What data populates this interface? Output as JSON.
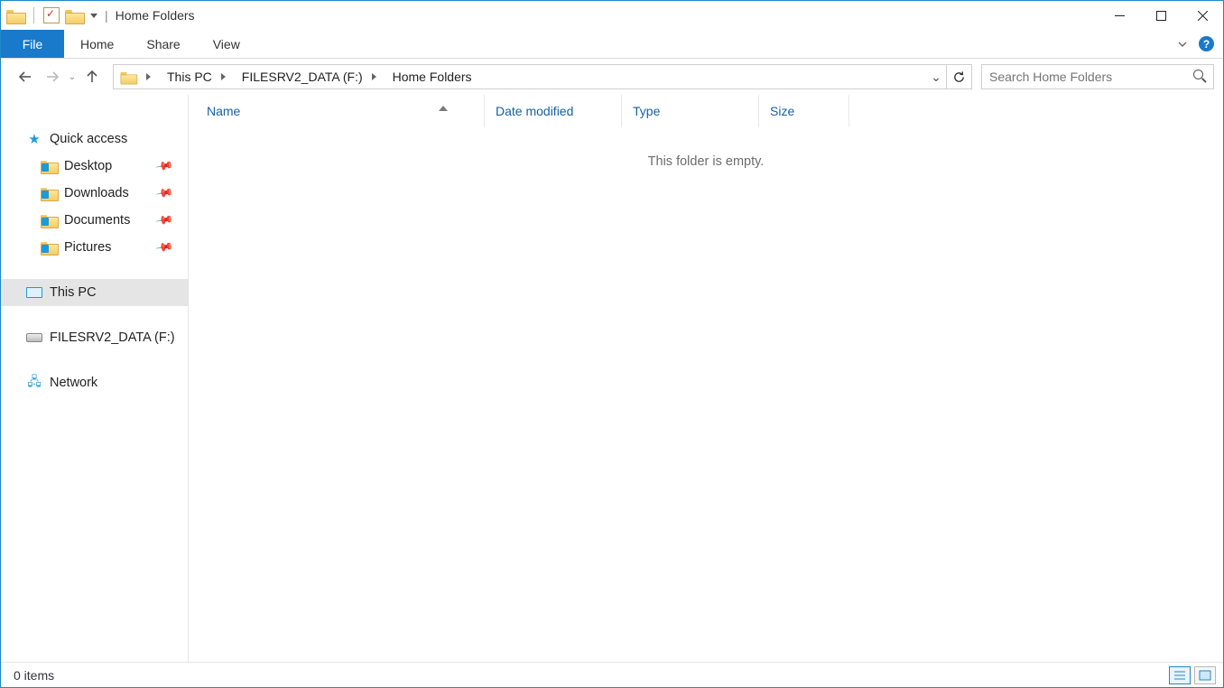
{
  "window": {
    "title": "Home Folders"
  },
  "ribbon": {
    "file": "File",
    "tabs": [
      "Home",
      "Share",
      "View"
    ]
  },
  "breadcrumb": [
    "This PC",
    "FILESRV2_DATA (F:)",
    "Home Folders"
  ],
  "search": {
    "placeholder": "Search Home Folders"
  },
  "navpane": {
    "quick_access": "Quick access",
    "quick_items": [
      "Desktop",
      "Downloads",
      "Documents",
      "Pictures"
    ],
    "this_pc": "This PC",
    "drive": "FILESRV2_DATA (F:)",
    "network": "Network"
  },
  "columns": {
    "name": "Name",
    "date": "Date modified",
    "type": "Type",
    "size": "Size"
  },
  "content": {
    "empty": "This folder is empty."
  },
  "status": {
    "items": "0 items"
  }
}
